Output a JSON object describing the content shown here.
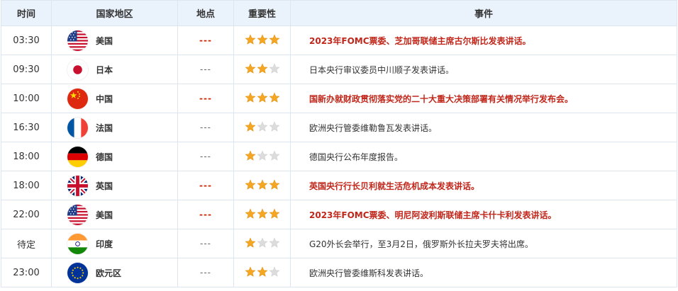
{
  "columns": {
    "time": "时间",
    "country": "国家地区",
    "place": "地点",
    "importance": "重要性",
    "event": "事件"
  },
  "colors": {
    "star_on": "#f5a623",
    "star_off": "#dcdcdc",
    "highlight_text": "#c0261a",
    "header_bg": "#eaf2fb"
  },
  "rows": [
    {
      "time": "03:30",
      "country": "美国",
      "flag": "us-flag",
      "place": "---",
      "importance": 3,
      "event": "2023年FOMC票委、芝加哥联储主席古尔斯比发表讲话。",
      "highlight": true
    },
    {
      "time": "09:30",
      "country": "日本",
      "flag": "jp-flag",
      "place": "---",
      "importance": 2,
      "event": "日本央行审议委员中川顺子发表讲话。",
      "highlight": false
    },
    {
      "time": "10:00",
      "country": "中国",
      "flag": "cn-flag",
      "place": "---",
      "importance": 3,
      "event": "国新办就财政贯彻落实党的二十大重大决策部署有关情况举行发布会。",
      "highlight": true
    },
    {
      "time": "16:30",
      "country": "法国",
      "flag": "fr-flag",
      "place": "---",
      "importance": 1,
      "event": "欧洲央行管委维勒鲁瓦发表讲话。",
      "highlight": false
    },
    {
      "time": "18:00",
      "country": "德国",
      "flag": "de-flag",
      "place": "---",
      "importance": 1,
      "event": "德国央行公布年度报告。",
      "highlight": false
    },
    {
      "time": "18:00",
      "country": "英国",
      "flag": "gb-flag",
      "place": "---",
      "importance": 3,
      "event": "英国央行行长贝利就生活危机成本发表讲话。",
      "highlight": true
    },
    {
      "time": "22:00",
      "country": "美国",
      "flag": "us-flag",
      "place": "---",
      "importance": 3,
      "event": "2023年FOMC票委、明尼阿波利斯联储主席卡什卡利发表讲话。",
      "highlight": true
    },
    {
      "time": "待定",
      "country": "印度",
      "flag": "in-flag",
      "place": "---",
      "importance": 1,
      "event": "G20外长会举行，至3月2日，俄罗斯外长拉夫罗夫将出席。",
      "highlight": false
    },
    {
      "time": "23:00",
      "country": "欧元区",
      "flag": "eu-flag",
      "place": "---",
      "importance": 2,
      "event": "欧洲央行管委维斯科发表讲话。",
      "highlight": false
    }
  ]
}
